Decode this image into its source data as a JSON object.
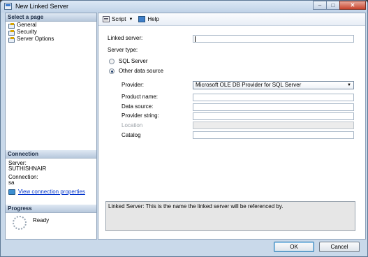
{
  "window": {
    "title": "New Linked Server",
    "controls": {
      "minimize": "–",
      "maximize": "□",
      "close": "✕"
    }
  },
  "left_pane": {
    "select_page_header": "Select a page",
    "pages": [
      {
        "label": "General",
        "icon": "page-icon"
      },
      {
        "label": "Security",
        "icon": "page-icon"
      },
      {
        "label": "Server Options",
        "icon": "page-icon"
      }
    ],
    "connection": {
      "header": "Connection",
      "server_label": "Server:",
      "server_value": "SUTHISHNAIR",
      "connection_label": "Connection:",
      "connection_value": "sa",
      "view_link": "View connection properties"
    },
    "progress": {
      "header": "Progress",
      "status": "Ready"
    }
  },
  "toolbar": {
    "script_label": "Script",
    "help_label": "Help"
  },
  "form": {
    "linked_server_label": "Linked server:",
    "linked_server_value": "",
    "server_type_label": "Server type:",
    "sql_server_label": "SQL Server",
    "other_source_label": "Other data source",
    "selected_server_type": "Other data source",
    "provider_label": "Provider:",
    "provider_value": "Microsoft OLE DB Provider for SQL Server",
    "product_name_label": "Product name:",
    "product_name_value": "",
    "data_source_label": "Data source:",
    "data_source_value": "",
    "provider_string_label": "Provider string:",
    "provider_string_value": "",
    "location_label": "Location",
    "location_value": "",
    "catalog_label": "Catalog",
    "catalog_value": ""
  },
  "description": "Linked Server: This is the name the linked server will be referenced by.",
  "buttons": {
    "ok": "OK",
    "cancel": "Cancel"
  },
  "colors": {
    "window_frame": "#c9d9ea",
    "link": "#0033cc",
    "header_text": "#1b2b44"
  }
}
